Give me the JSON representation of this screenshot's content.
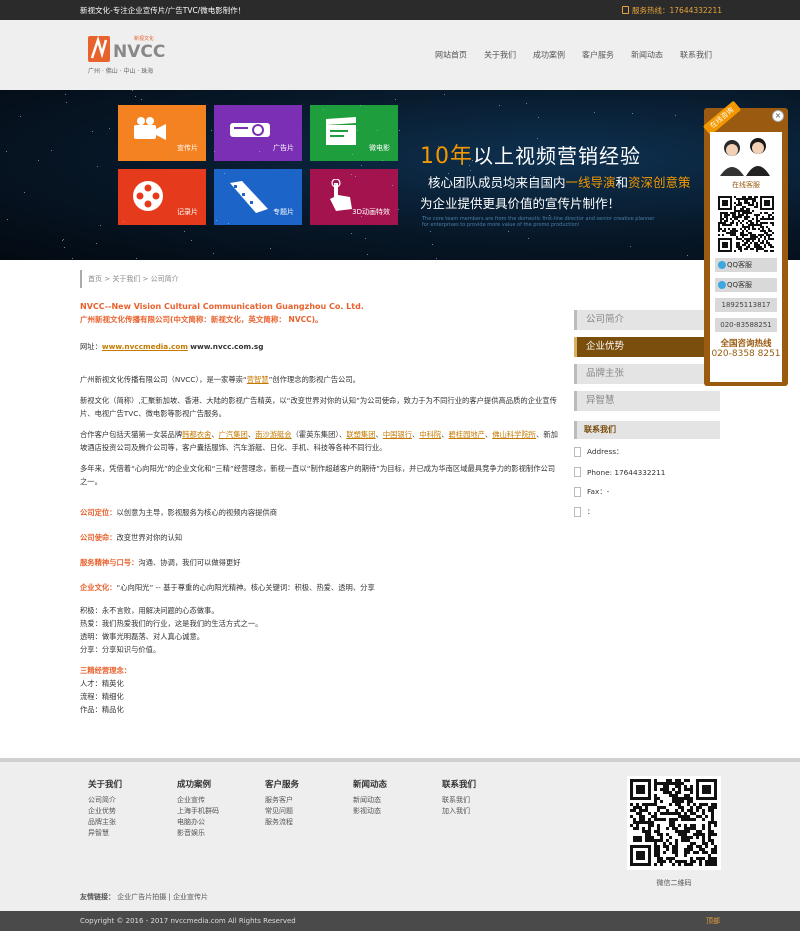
{
  "topbar": {
    "slogan": "新视文化-专注企业宣传片/广告TVC/微电影制作！",
    "hotline": "服务热线：17644332211"
  },
  "logo": {
    "brand": "NVCC",
    "cn": "新视文化",
    "cities": "广州 · 佛山 · 中山 · 珠海"
  },
  "nav": [
    "网站首页",
    "关于我们",
    "成功案例",
    "客户服务",
    "新闻动态",
    "联系我们"
  ],
  "banner": {
    "tiles": [
      {
        "label": "宣传片",
        "color": "#f58220",
        "icon": "camera-icon"
      },
      {
        "label": "广告片",
        "color": "#7b2fb5",
        "icon": "projector-icon"
      },
      {
        "label": "微电影",
        "color": "#1e9e3d",
        "icon": "clapperboard-icon"
      },
      {
        "label": "记录片",
        "color": "#e53a1c",
        "icon": "film-reel-icon"
      },
      {
        "label": "专题片",
        "color": "#1d64c8",
        "icon": "film-strip-icon"
      },
      {
        "label": "3D动画特效",
        "color": "#a3134e",
        "icon": "hand-cursor-icon"
      }
    ],
    "slogan_big": "10年",
    "slogan_l1": "以上视频营销经验",
    "slogan_l2a": "核心团队成员均来自国内",
    "slogan_l2b": "一线导演",
    "slogan_l2c": "和",
    "slogan_l2d": "资深创意策",
    "slogan_l3": "为企业提供更具价值的宣传片制作！",
    "slogan_en": "The core team members are from the domestic first-line director and senior creative planner",
    "slogan_en2": "for enterprises to provide more value of the promo production!"
  },
  "breadcrumb": "首页 > 关于我们 > 公司简介",
  "content": {
    "title_en": "NVCC--New Vision Cultural Communication Guangzhou Co. Ltd.",
    "title_cn": "广州新视文化传播有限公司(中文简称：新视文化，英文简称： NVCC)。",
    "site_label": "网址：",
    "site1": "www.nvccmedia.com",
    "site2": "www.nvcc.com.sg",
    "p1a": "广州新视文化传播有限公司（NVCC），是一家尊崇“",
    "p1b": "营智慧",
    "p1c": "”创作理念的影视广告公司。",
    "p2": "新视文化（简称）,汇聚新加坡、香港、大陆的影视广告精英，以“改变世界对你的认知”为公司使命，致力于为不同行业的客户提供高品质的企业宣传片、电视广告TVC、微电影等影视广告服务。",
    "p3a": "合作客户包括天猫第一女装品牌",
    "p3_links": [
      "韩都衣舍",
      "广汽集团",
      "南沙游艇会",
      "联塑集团",
      "中国银行",
      "中科院",
      "碧桂园地产",
      "佛山科学院所"
    ],
    "p3_mid": "（霍英东集团）、",
    "p3b": "、新加坡酒店投资公司及腾介公司等，客户囊括服饰、汽车游艇、日化、手机、科技等各种不同行业。",
    "p4": "多年来，凭借着“心向阳光”的企业文化和“三精”经营理念，新视一直以“制作超越客户的期待”为目标，并已成为华南区域最具竞争力的影视制作公司之一。",
    "pos_label": "公司定位：",
    "pos": "以创意为主导，影视服务为核心的视频内容提供商",
    "mission_label": "公司使命：",
    "mission": "改变世界对你的认知",
    "service_label": "服务精神与口号：",
    "service": "沟通、协调，我们可以做得更好",
    "culture_label": "企业文化：",
    "culture": "“心向阳光” -- 基于尊重的心向阳光精神。核心关键词：积极、热爱、透明、分享",
    "values": [
      "积极：永不言败，用解决问题的心态做事。",
      "热爱：我们热爱我们的行业，这是我们的生活方式之一。",
      "透明：做事光明磊落、对人真心诚意。",
      "分享：分享知识与价值。"
    ],
    "three_label": "三精经营理念：",
    "three": [
      "人才：精英化",
      "流程：精细化",
      "作品：精品化"
    ]
  },
  "sidebar": {
    "items": [
      "公司简介",
      "企业优势",
      "品牌主张",
      "异智慧"
    ],
    "active_index": 1,
    "contact_title": "联系我们",
    "address": "Address：",
    "phone": "Phone: 17644332211",
    "fax": "Fax：-",
    "email": "："
  },
  "float_panel": {
    "ribbon": "在线咨询",
    "online": "在线客服",
    "qq1": "QQ客服",
    "qq2": "QQ客服",
    "num1": "18925113817",
    "num2": "020-83588251",
    "hot_title": "全国咨询热线",
    "hot_number": "020-8358 8251",
    "close": "×"
  },
  "footer": {
    "cols": [
      {
        "title": "关于我们",
        "items": [
          "公司简介",
          "企业优势",
          "品牌主张",
          "异智慧"
        ]
      },
      {
        "title": "成功案例",
        "items": [
          "企业宣传",
          "上海手机群码",
          "电脑办公",
          "影音娱乐"
        ]
      },
      {
        "title": "客户服务",
        "items": [
          "服务客户",
          "常见问题",
          "服务流程"
        ]
      },
      {
        "title": "新闻动态",
        "items": [
          "新闻动态",
          "影视动态"
        ]
      },
      {
        "title": "联系我们",
        "items": [
          "联系我们",
          "加入我们"
        ]
      }
    ],
    "qr_label": "微信二维码",
    "friend_label": "友情链接：",
    "friend_links": "企业广告片拍摄 | 企业宣传片",
    "copyright": "Copyright © 2016 - 2017 nvccmedia.com All Rights Reserved",
    "top": "顶部"
  }
}
